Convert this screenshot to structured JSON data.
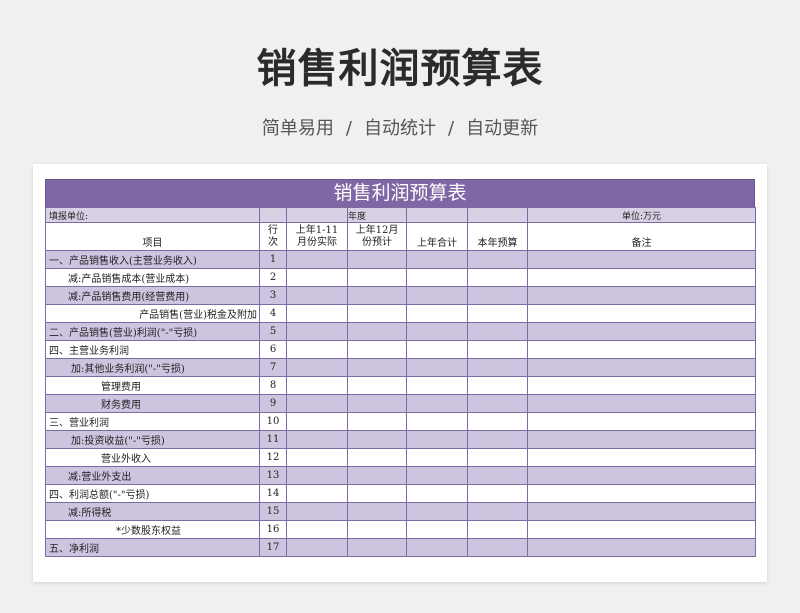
{
  "hero": {
    "title": "销售利润预算表",
    "subtitle_parts": [
      "简单易用",
      "/",
      "自动统计",
      "/",
      "自动更新"
    ]
  },
  "sheet": {
    "title": "销售利润预算表",
    "info": {
      "unit_label": "填报单位:",
      "year_label": "年度",
      "currency_label": "单位:万元"
    },
    "headers": {
      "item": "项目",
      "no_line1": "行",
      "no_line2": "次",
      "c1_line1": "上年1-11",
      "c1_line2": "月份实际",
      "c2_line1": "上年12月",
      "c2_line2": "份预计",
      "c3": "上年合计",
      "c4": "本年预算",
      "c5": "备注"
    },
    "rows": [
      {
        "label": "一、产品销售收入(主营业务收入)",
        "no": "1"
      },
      {
        "label": "减:产品销售成本(营业成本)",
        "no": "2"
      },
      {
        "label": "减:产品销售费用(经营费用)",
        "no": "3"
      },
      {
        "label": "产品销售(营业)税金及附加",
        "no": "4"
      },
      {
        "label": "二、产品销售(营业)利润(\"-\"亏损)",
        "no": "5"
      },
      {
        "label": "四、主营业务利润",
        "no": "6"
      },
      {
        "label": "加:其他业务利润(\"-\"亏损)",
        "no": "7"
      },
      {
        "label": "管理费用",
        "no": "8"
      },
      {
        "label": "财务费用",
        "no": "9"
      },
      {
        "label": "三、营业利润",
        "no": "10"
      },
      {
        "label": "加:投资收益(\"-\"亏损)",
        "no": "11"
      },
      {
        "label": "营业外收入",
        "no": "12"
      },
      {
        "label": "减:营业外支出",
        "no": "13"
      },
      {
        "label": "四、利润总额(\"-\"亏损)",
        "no": "14"
      },
      {
        "label": "减:所得税",
        "no": "15"
      },
      {
        "label": "*少数股东权益",
        "no": "16"
      },
      {
        "label": "五、净利润",
        "no": "17"
      }
    ]
  },
  "colors": {
    "header_purple": "#7f67a5",
    "row_shade": "#cdc4e0",
    "info_shade": "#d8d1e6"
  }
}
